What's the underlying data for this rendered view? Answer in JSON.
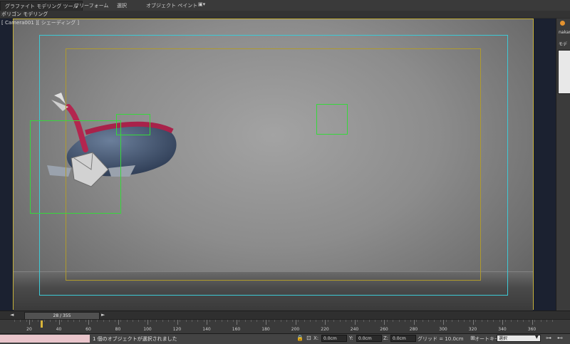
{
  "ribbon": {
    "tabs": [
      {
        "label": "グラファイト モデリング ツール"
      },
      {
        "label": "フリーフォーム"
      },
      {
        "label": "選択"
      },
      {
        "label": "オブジェクト ペイント"
      }
    ],
    "sub_tab": "ポリゴン モデリング"
  },
  "viewport": {
    "label": "[ Camera001 ][ シェーディング ]"
  },
  "right_panel": {
    "name_prefix": "nakar",
    "modifier_prefix": "モデ"
  },
  "timeline": {
    "frame_display": "28 / 355",
    "current_frame": 28,
    "total_frames": 355,
    "ticks": [
      "20",
      "40",
      "60",
      "80",
      "100",
      "120",
      "140",
      "160",
      "180",
      "200",
      "220",
      "240",
      "260",
      "280",
      "300",
      "320",
      "340",
      "360"
    ]
  },
  "status": {
    "message": "1 個のオブジェクトが選択されました",
    "x_label": "X:",
    "x_value": "0.0cm",
    "y_label": "Y:",
    "y_value": "0.0cm",
    "z_label": "Z:",
    "z_value": "0.0cm",
    "grid_label": "グリッド = 10.0cm",
    "autokey_label": "オートキー",
    "selection_value": "選択"
  },
  "colors": {
    "selection_box": "#36d83b",
    "safe_action": "#3ec9d6",
    "safe_title": "#b09a2c",
    "maxscript_listener": "#e9c5cb"
  }
}
